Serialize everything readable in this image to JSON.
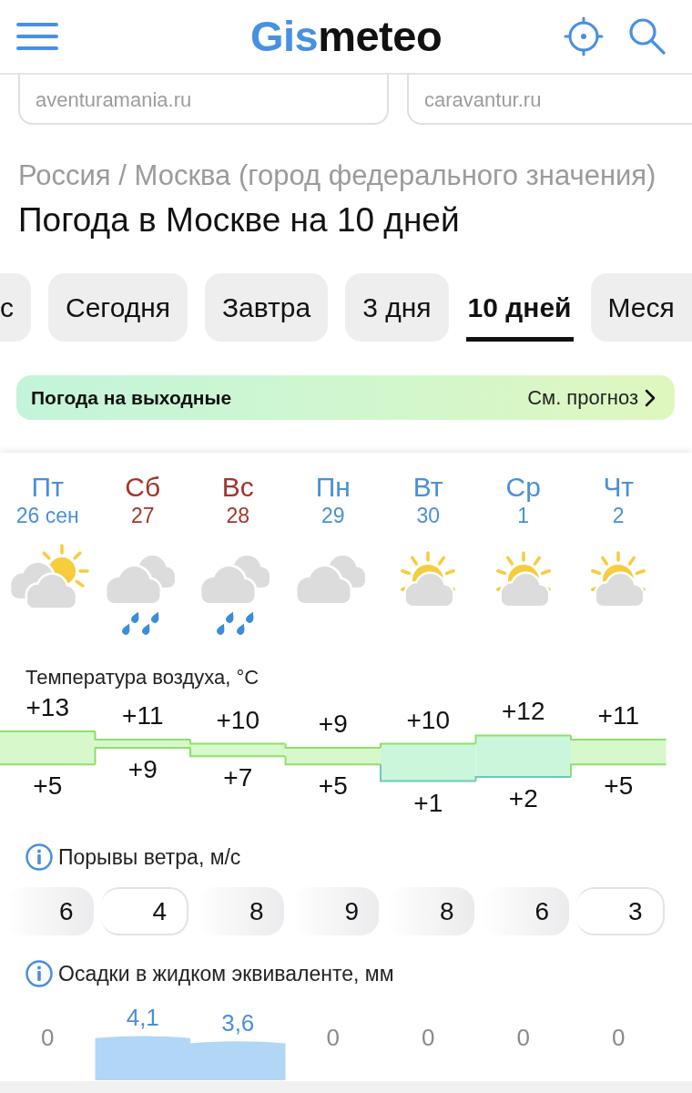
{
  "header": {
    "logo": [
      {
        "text": "Gis",
        "accent": true
      },
      {
        "text": "meteo",
        "accent": false
      }
    ]
  },
  "ad_links": [
    "aventuramania.ru",
    "caravantur.ru"
  ],
  "breadcrumb": "Россия / Москва (город федерального значения)",
  "title": "Погода в Москве на 10 дней",
  "tabs": [
    {
      "label": "с",
      "selected": false
    },
    {
      "label": "Сегодня",
      "selected": false
    },
    {
      "label": "Завтра",
      "selected": false
    },
    {
      "label": "3 дня",
      "selected": false
    },
    {
      "label": "10 дней",
      "selected": true
    },
    {
      "label": "Меся",
      "selected": false
    }
  ],
  "weekend_banner": {
    "title": "Погода на выходные",
    "link": "См. прогноз"
  },
  "days": [
    {
      "weekday": "Пт",
      "date": "26 сен",
      "weekend": false,
      "kind": "cloudy"
    },
    {
      "weekday": "Сб",
      "date": "27",
      "weekend": true,
      "kind": "rain"
    },
    {
      "weekday": "Вс",
      "date": "28",
      "weekend": true,
      "kind": "rain"
    },
    {
      "weekday": "Пн",
      "date": "29",
      "weekend": false,
      "kind": "overcast"
    },
    {
      "weekday": "Вт",
      "date": "30",
      "weekend": false,
      "kind": "fair"
    },
    {
      "weekday": "Ср",
      "date": "1",
      "weekend": false,
      "kind": "fair"
    },
    {
      "weekday": "Чт",
      "date": "2",
      "weekend": false,
      "kind": "fair"
    }
  ],
  "temperature": {
    "title": "Температура воздуха, °C",
    "highs": [
      "+13",
      "+11",
      "+10",
      "+9",
      "+10",
      "+12",
      "+11"
    ],
    "lows": [
      "+5",
      "+9",
      "+7",
      "+5",
      "+1",
      "+2",
      "+5"
    ]
  },
  "wind_gusts": {
    "title": "Порывы ветра, м/с",
    "values": [
      {
        "value": "6",
        "highlighted": true
      },
      {
        "value": "4",
        "highlighted": false
      },
      {
        "value": "8",
        "highlighted": true
      },
      {
        "value": "9",
        "highlighted": true
      },
      {
        "value": "8",
        "highlighted": true
      },
      {
        "value": "6",
        "highlighted": true
      },
      {
        "value": "3",
        "highlighted": false
      }
    ]
  },
  "precipitation": {
    "title": "Осадки в жидком эквиваленте, мм",
    "amounts": [
      "0",
      "4,1",
      "3,6",
      "0",
      "0",
      "0",
      "0"
    ]
  }
}
